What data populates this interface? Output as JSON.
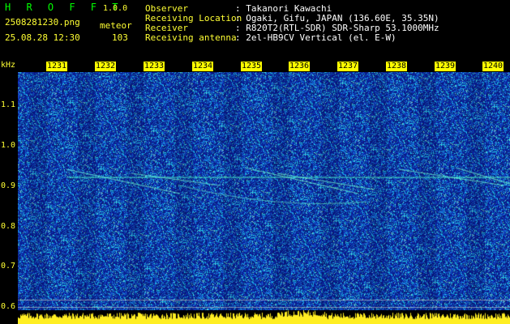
{
  "header": {
    "app_name": "H R O F F T",
    "version": "1.0.0",
    "filename": "2508281230.png",
    "mode": "meteor",
    "datetime": "25.08.28 12:30",
    "count": "103",
    "observer_label": "Observer",
    "observer_value": ": Takanori Kawachi",
    "location_label": "Receiving Location",
    "location_value": ": Ogaki, Gifu, JAPAN (136.60E, 35.35N)",
    "receiver_label": "Receiver",
    "receiver_value": ": R820T2(RTL-SDR) SDR-Sharp 53.1000MHz",
    "antenna_label": "Receiving antenna",
    "antenna_value": ": 2el-HB9CV Vertical (el. E-W)"
  },
  "axis": {
    "unit": "kHz",
    "y_ticks": [
      "1.1",
      "1.0",
      "0.9",
      "0.8",
      "0.7",
      "0.6"
    ],
    "y_range": [
      0.58,
      1.19
    ],
    "time_ticks": [
      "1231",
      "1232",
      "1233",
      "1234",
      "1235",
      "1236",
      "1237",
      "1238",
      "1239",
      "1240"
    ]
  },
  "colors": {
    "background_noise": "#1a2a9a",
    "trace": "#33ffcc",
    "label_yellow": "#ffff33",
    "label_green": "#00ff00"
  }
}
